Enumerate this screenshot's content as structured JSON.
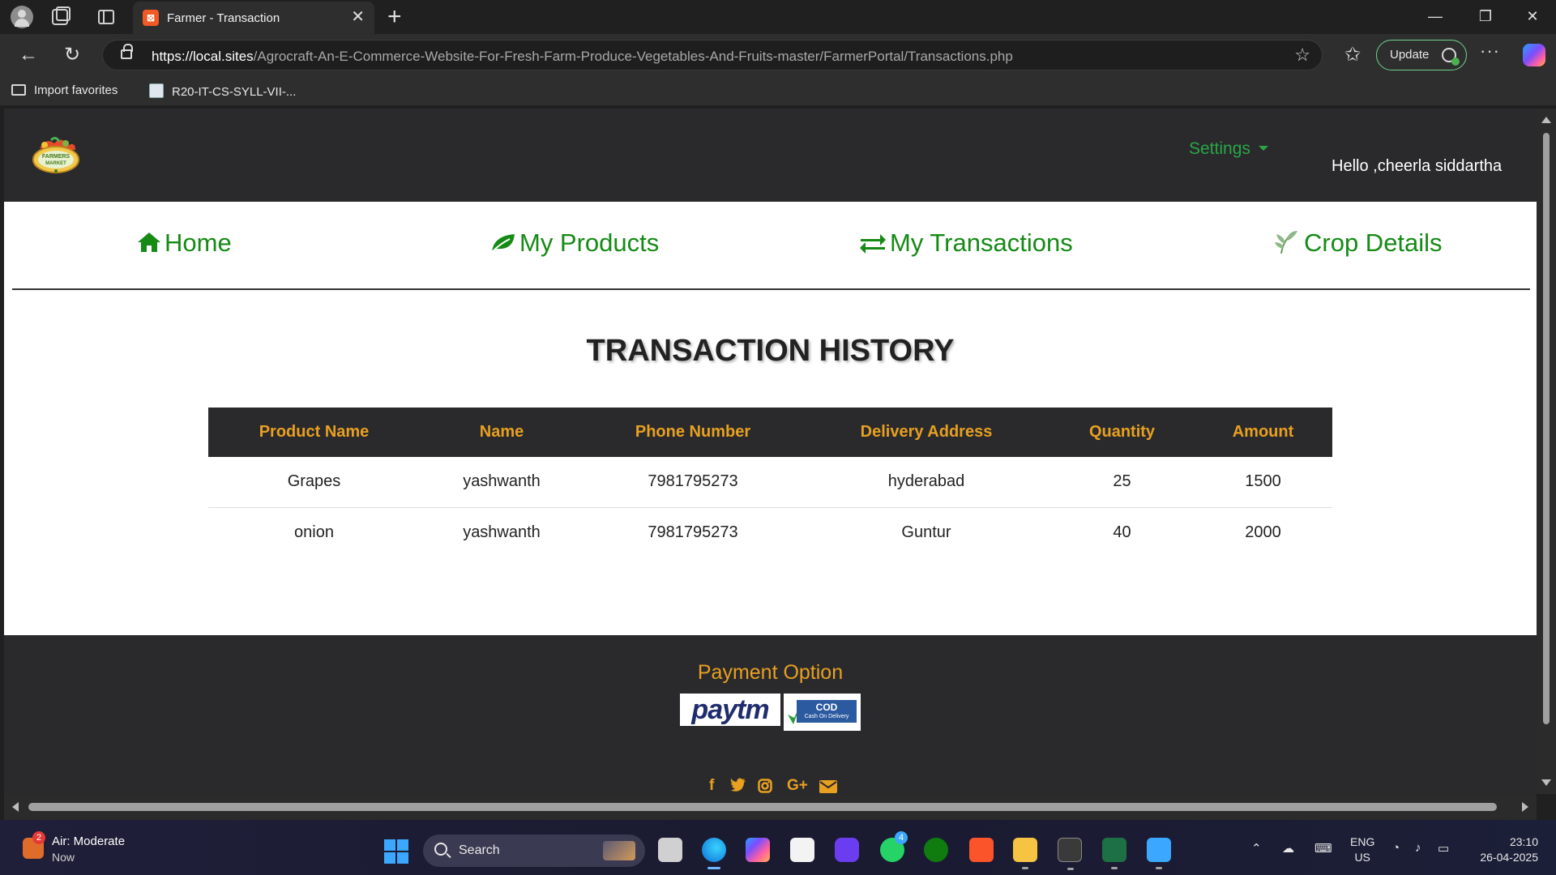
{
  "browser": {
    "tab_title": "Farmer - Transaction",
    "url_host": "https://local.sites",
    "url_path": "/Agrocraft-An-E-Commerce-Website-For-Fresh-Farm-Produce-Vegetables-And-Fruits-master/FarmerPortal/Transactions.php",
    "update_label": "Update",
    "favorites": [
      "Import favorites",
      "R20-IT-CS-SYLL-VII-..."
    ]
  },
  "header": {
    "logo_text": "FARMERS MARKET",
    "settings_label": "Settings",
    "greeting": "Hello ,cheerla siddartha"
  },
  "nav": {
    "home": "Home",
    "products": "My Products",
    "transactions": "My Transactions",
    "crops": "Crop Details"
  },
  "page": {
    "title": "TRANSACTION HISTORY"
  },
  "table": {
    "columns": [
      "Product Name",
      "Name",
      "Phone Number",
      "Delivery Address",
      "Quantity",
      "Amount"
    ],
    "rows": [
      [
        "Grapes",
        "yashwanth",
        "7981795273",
        "hyderabad",
        "25",
        "1500"
      ],
      [
        "onion",
        "yashwanth",
        "7981795273",
        "Guntur",
        "40",
        "2000"
      ]
    ]
  },
  "footer": {
    "payment_title": "Payment Option",
    "paytm_label": "paytm",
    "cod_label": "COD",
    "cod_sub": "Cash On Delivery",
    "social_icons": [
      "facebook-icon",
      "twitter-icon",
      "instagram-icon",
      "google-plus-icon",
      "envelope-icon"
    ]
  },
  "taskbar": {
    "weather_title": "Air: Moderate",
    "weather_sub": "Now",
    "weather_badge": "2",
    "search_label": "Search",
    "whatsapp_badge": "4",
    "lang_line1": "ENG",
    "lang_line2": "US",
    "time": "23:10",
    "date": "26-04-2025"
  },
  "colors": {
    "nav_green": "#158a15",
    "settings_green": "#28a745",
    "accent_orange": "#e8a020",
    "dark_bg": "#2a2a2d"
  }
}
